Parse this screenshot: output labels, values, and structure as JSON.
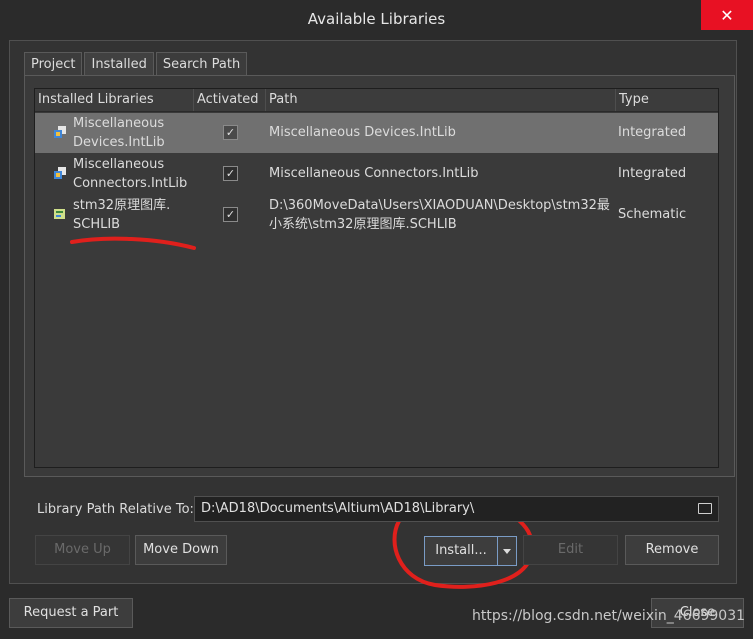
{
  "window": {
    "title": "Available Libraries",
    "close_glyph": "✕"
  },
  "tabs": [
    {
      "label": "Project"
    },
    {
      "label": "Installed"
    },
    {
      "label": "Search Path"
    }
  ],
  "table": {
    "headers": [
      "Installed Libraries",
      "Activated",
      "Path",
      "Type"
    ],
    "rows": [
      {
        "name": "Miscellaneous Devices.IntLib",
        "name_lines": [
          "Miscellaneous",
          "Devices.IntLib"
        ],
        "activated": true,
        "path_lines": [
          "Miscellaneous Devices.IntLib"
        ],
        "type": "Integrated",
        "selected": true
      },
      {
        "name": "Miscellaneous Connectors.IntLib",
        "name_lines": [
          "Miscellaneous",
          "Connectors.IntLib"
        ],
        "activated": true,
        "path_lines": [
          "Miscellaneous Connectors.IntLib"
        ],
        "type": "Integrated",
        "selected": false
      },
      {
        "name": "stm32原理图库.SCHLIB",
        "name_lines": [
          "stm32原理图库.",
          "SCHLIB"
        ],
        "activated": true,
        "path_lines": [
          "D:\\360MoveData\\Users\\XIAODUAN\\Desktop\\stm32最",
          "小系统\\stm32原理图库.SCHLIB"
        ],
        "type": "Schematic",
        "selected": false
      }
    ]
  },
  "library_path": {
    "label": "Library Path Relative To:",
    "value": "D:\\AD18\\Documents\\Altium\\AD18\\Library\\"
  },
  "buttons": {
    "move_up": "Move Up",
    "move_down": "Move Down",
    "install": "Install...",
    "edit": "Edit",
    "remove": "Remove",
    "request_part": "Request a Part",
    "close": "Close"
  },
  "watermark": "https://blog.csdn.net/weixin_46699031",
  "colors": {
    "selected_row": "#707070",
    "annotation_red": "#e0201c",
    "close_button": "#e81123"
  }
}
